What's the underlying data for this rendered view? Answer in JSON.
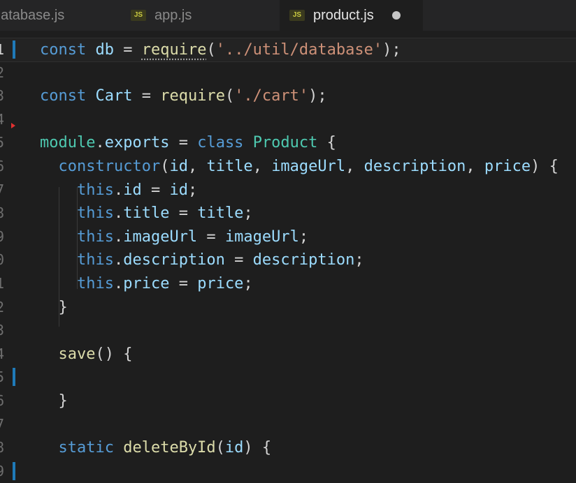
{
  "tabs": [
    {
      "label": "database.js",
      "icon": "js-file-icon",
      "active": false
    },
    {
      "label": "app.js",
      "icon": "js-file-icon",
      "badge": "JS",
      "active": false
    },
    {
      "label": "product.js",
      "icon": "js-file-icon",
      "badge": "JS",
      "active": true,
      "modified": true
    }
  ],
  "editor": {
    "line_numbers": [
      "1",
      "2",
      "3",
      "4",
      "5",
      "6",
      "7",
      "8",
      "9",
      "0",
      "1",
      "2",
      "3",
      "4",
      "5",
      "6",
      "7",
      "8",
      "9"
    ],
    "lines": [
      {
        "tokens": [
          [
            "kw",
            "const "
          ],
          [
            "var",
            "db"
          ],
          [
            "pl",
            " = "
          ],
          [
            "fn",
            "require"
          ],
          [
            "pl",
            "("
          ],
          [
            "str",
            "'../util/database'"
          ],
          [
            "pl",
            ");"
          ]
        ]
      },
      {
        "tokens": []
      },
      {
        "tokens": [
          [
            "kw",
            "const "
          ],
          [
            "var",
            "Cart"
          ],
          [
            "pl",
            " = "
          ],
          [
            "fn",
            "require"
          ],
          [
            "pl",
            "("
          ],
          [
            "str",
            "'./cart'"
          ],
          [
            "pl",
            ");"
          ]
        ]
      },
      {
        "tokens": []
      },
      {
        "tokens": [
          [
            "cls",
            "module"
          ],
          [
            "pl",
            "."
          ],
          [
            "var",
            "exports"
          ],
          [
            "pl",
            " = "
          ],
          [
            "kw",
            "class "
          ],
          [
            "cls",
            "Product"
          ],
          [
            "pl",
            " {"
          ]
        ]
      },
      {
        "tokens": [
          [
            "pl",
            "  "
          ],
          [
            "kw",
            "constructor"
          ],
          [
            "pl",
            "("
          ],
          [
            "var",
            "id"
          ],
          [
            "pl",
            ", "
          ],
          [
            "var",
            "title"
          ],
          [
            "pl",
            ", "
          ],
          [
            "var",
            "imageUrl"
          ],
          [
            "pl",
            ", "
          ],
          [
            "var",
            "description"
          ],
          [
            "pl",
            ", "
          ],
          [
            "var",
            "price"
          ],
          [
            "pl",
            ") {"
          ]
        ]
      },
      {
        "tokens": [
          [
            "pl",
            "    "
          ],
          [
            "kw",
            "this"
          ],
          [
            "pl",
            "."
          ],
          [
            "var",
            "id"
          ],
          [
            "pl",
            " = "
          ],
          [
            "var",
            "id"
          ],
          [
            "pl",
            ";"
          ]
        ]
      },
      {
        "tokens": [
          [
            "pl",
            "    "
          ],
          [
            "kw",
            "this"
          ],
          [
            "pl",
            "."
          ],
          [
            "var",
            "title"
          ],
          [
            "pl",
            " = "
          ],
          [
            "var",
            "title"
          ],
          [
            "pl",
            ";"
          ]
        ]
      },
      {
        "tokens": [
          [
            "pl",
            "    "
          ],
          [
            "kw",
            "this"
          ],
          [
            "pl",
            "."
          ],
          [
            "var",
            "imageUrl"
          ],
          [
            "pl",
            " = "
          ],
          [
            "var",
            "imageUrl"
          ],
          [
            "pl",
            ";"
          ]
        ]
      },
      {
        "tokens": [
          [
            "pl",
            "    "
          ],
          [
            "kw",
            "this"
          ],
          [
            "pl",
            "."
          ],
          [
            "var",
            "description"
          ],
          [
            "pl",
            " = "
          ],
          [
            "var",
            "description"
          ],
          [
            "pl",
            ";"
          ]
        ]
      },
      {
        "tokens": [
          [
            "pl",
            "    "
          ],
          [
            "kw",
            "this"
          ],
          [
            "pl",
            "."
          ],
          [
            "var",
            "price"
          ],
          [
            "pl",
            " = "
          ],
          [
            "var",
            "price"
          ],
          [
            "pl",
            ";"
          ]
        ]
      },
      {
        "tokens": [
          [
            "pl",
            "  }"
          ]
        ]
      },
      {
        "tokens": []
      },
      {
        "tokens": [
          [
            "pl",
            "  "
          ],
          [
            "fn",
            "save"
          ],
          [
            "pl",
            "() {"
          ]
        ]
      },
      {
        "tokens": []
      },
      {
        "tokens": [
          [
            "pl",
            "  }"
          ]
        ]
      },
      {
        "tokens": []
      },
      {
        "tokens": [
          [
            "pl",
            "  "
          ],
          [
            "kw",
            "static "
          ],
          [
            "fn",
            "deleteById"
          ],
          [
            "pl",
            "("
          ],
          [
            "var",
            "id"
          ],
          [
            "pl",
            ") {"
          ]
        ]
      },
      {
        "tokens": []
      }
    ]
  },
  "colors": {
    "keyword": "#569cd6",
    "string": "#ce9178",
    "function": "#dcdcaa",
    "variable": "#9cdcfe",
    "class": "#4ec9b0",
    "git_modified": "#1f7ab8"
  }
}
